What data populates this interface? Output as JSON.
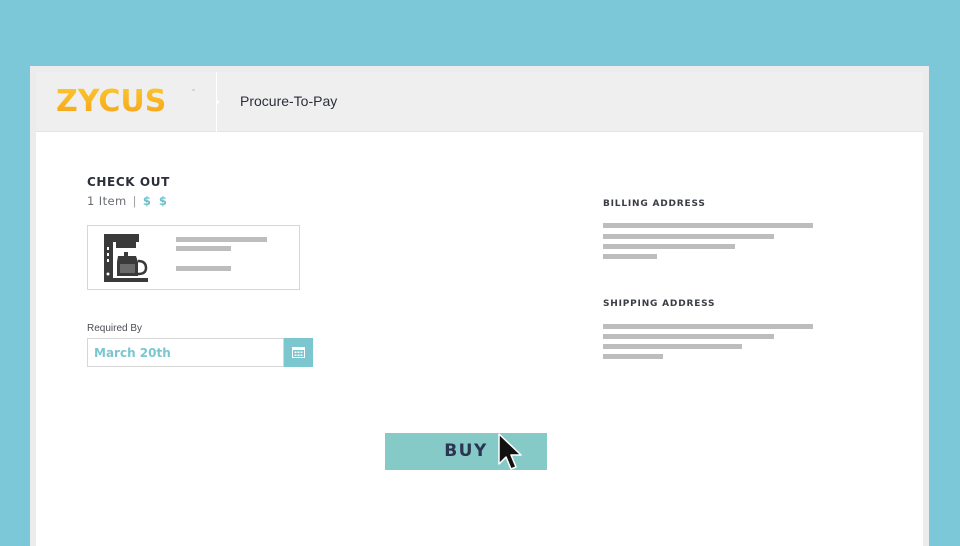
{
  "header": {
    "logo_text": "ZYCUS",
    "logo_tm": "™",
    "app_title": "Procure-To-Pay"
  },
  "checkout": {
    "title": "CHECK OUT",
    "item_count": "1 Item",
    "separator": "|",
    "price": "$ $"
  },
  "required_by": {
    "label": "Required By",
    "value": "March 20th"
  },
  "billing": {
    "title": "BILLING ADDRESS"
  },
  "shipping": {
    "title": "SHIPPING ADDRESS"
  },
  "buy": {
    "label": "BUY"
  },
  "icons": {
    "product": "coffee-maker-icon",
    "calendar": "calendar-icon",
    "cursor": "mouse-pointer-icon"
  },
  "colors": {
    "background": "#7cc8d9",
    "accent": "#7cc6cf",
    "buy_button": "#86cac8",
    "logo": "#f7b21d",
    "placeholder_lines": "#bdbdbd",
    "text_dark": "#2b2f3a"
  }
}
